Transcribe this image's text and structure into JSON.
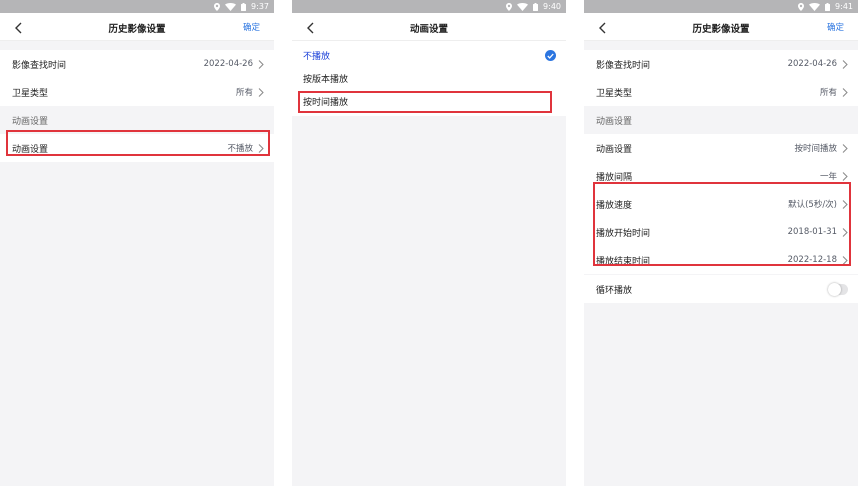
{
  "status_times": [
    "9:37",
    "9:40",
    "9:41"
  ],
  "screen1": {
    "title": "历史影像设置",
    "confirm": "确定",
    "rows": [
      {
        "label": "影像查找时间",
        "value": "2022-04-26"
      },
      {
        "label": "卫星类型",
        "value": "所有"
      }
    ],
    "section": "动画设置",
    "anim_row": {
      "label": "动画设置",
      "value": "不播放"
    }
  },
  "screen2": {
    "title": "动画设置",
    "options": [
      {
        "label": "不播放",
        "selected": true
      },
      {
        "label": "按版本播放",
        "selected": false
      },
      {
        "label": "按时间播放",
        "selected": false
      }
    ]
  },
  "screen3": {
    "title": "历史影像设置",
    "confirm": "确定",
    "rows": [
      {
        "label": "影像查找时间",
        "value": "2022-04-26"
      },
      {
        "label": "卫星类型",
        "value": "所有"
      }
    ],
    "section": "动画设置",
    "anim_rows": [
      {
        "label": "动画设置",
        "value": "按时间播放"
      },
      {
        "label": "播放间隔",
        "value": "一年"
      },
      {
        "label": "播放速度",
        "value": "默认(5秒/次)"
      },
      {
        "label": "播放开始时间",
        "value": "2018-01-31"
      },
      {
        "label": "播放结束时间",
        "value": "2022-12-18"
      }
    ],
    "loop_label": "循环播放",
    "loop_on": false
  },
  "colors": {
    "accent": "#2b75e0",
    "highlight": "#e0343c",
    "selected_text": "#1a3fd8"
  }
}
